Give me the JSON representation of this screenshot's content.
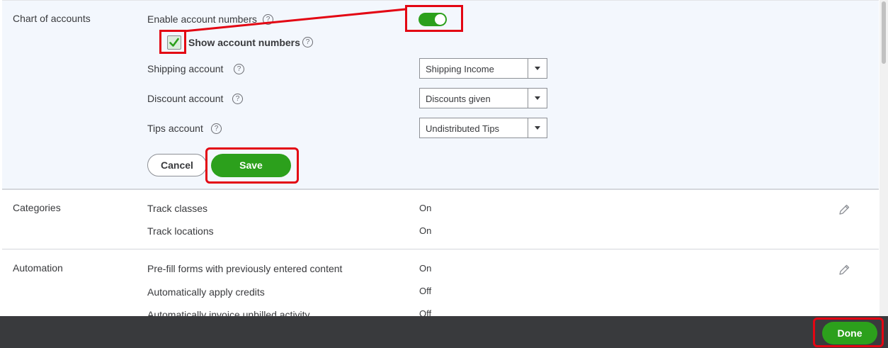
{
  "sections": {
    "chart_of_accounts": {
      "title": "Chart of accounts",
      "enable_account_numbers_label": "Enable account numbers",
      "enable_account_numbers_on": true,
      "show_account_numbers_label": "Show account numbers",
      "show_account_numbers_checked": true,
      "shipping_account": {
        "label": "Shipping account",
        "value": "Shipping Income"
      },
      "discount_account": {
        "label": "Discount account",
        "value": "Discounts given"
      },
      "tips_account": {
        "label": "Tips account",
        "value": "Undistributed Tips"
      },
      "cancel_label": "Cancel",
      "save_label": "Save"
    },
    "categories": {
      "title": "Categories",
      "rows": [
        {
          "label": "Track classes",
          "value": "On"
        },
        {
          "label": "Track locations",
          "value": "On"
        }
      ]
    },
    "automation": {
      "title": "Automation",
      "rows": [
        {
          "label": "Pre-fill forms with previously entered content",
          "value": "On"
        },
        {
          "label": "Automatically apply credits",
          "value": "Off"
        },
        {
          "label": "Automatically invoice unbilled activity",
          "value": "Off"
        }
      ]
    }
  },
  "icons": {
    "help": "help-circle-icon",
    "edit": "pencil-icon",
    "check": "checkmark-icon",
    "dropdown": "caret-down-icon"
  },
  "footer": {
    "done_label": "Done"
  },
  "colors": {
    "accent_green": "#2ca01c",
    "annotation_red": "#e30613",
    "edit_panel_bg": "#f3f7fd",
    "footer_bg": "#393a3d"
  }
}
